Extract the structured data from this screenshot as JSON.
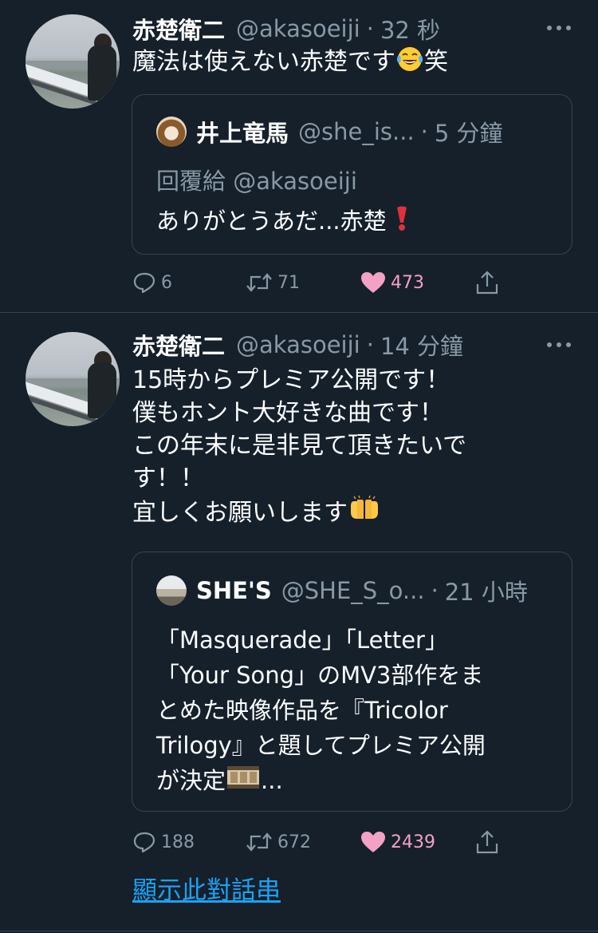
{
  "tweets": [
    {
      "author_name": "赤楚衛二",
      "handle": "@akasoeiji",
      "separator": "·",
      "time": "32 秒",
      "text": "魔法は使えない赤楚です",
      "text_suffix": "笑",
      "emoji": "face-with-tears-of-joy",
      "quote": {
        "author_name": "井上竜馬",
        "handle": "@she_is...",
        "separator": "·",
        "time": "5 分鐘",
        "reply_to": "回覆給 @akasoeiji",
        "text": "ありがとうあだ...赤楚",
        "emoji": "heavy-exclamation-mark"
      },
      "actions": {
        "replies": "6",
        "retweets": "71",
        "likes": "473"
      }
    },
    {
      "author_name": "赤楚衛二",
      "handle": "@akasoeiji",
      "separator": "·",
      "time": "14 分鐘",
      "lines": [
        "15時からプレミア公開です！",
        "僕もホント大好きな曲です！",
        "この年末に是非見て頂きたいで",
        "す！！",
        "宜しくお願いします"
      ],
      "emoji": "raising-hands",
      "quote": {
        "author_name": "SHE'S",
        "handle": "@SHE_S_o...",
        "separator": "·",
        "time": "21 小時",
        "lines": [
          "「Masquerade」「Letter」",
          "「Your Song」のMV3部作をま",
          "とめた映像作品を『Tricolor",
          "Trilogy』と題してプレミア公開",
          "が決定"
        ],
        "trailing": "...",
        "emoji": "film-frames"
      },
      "actions": {
        "replies": "188",
        "retweets": "672",
        "likes": "2439"
      }
    }
  ],
  "show_thread": "顯示此對話串",
  "colors": {
    "background": "#15202b",
    "secondary_text": "#8899a6",
    "border": "#38444d",
    "link": "#1da1f2",
    "like": "#f3a1c4"
  }
}
